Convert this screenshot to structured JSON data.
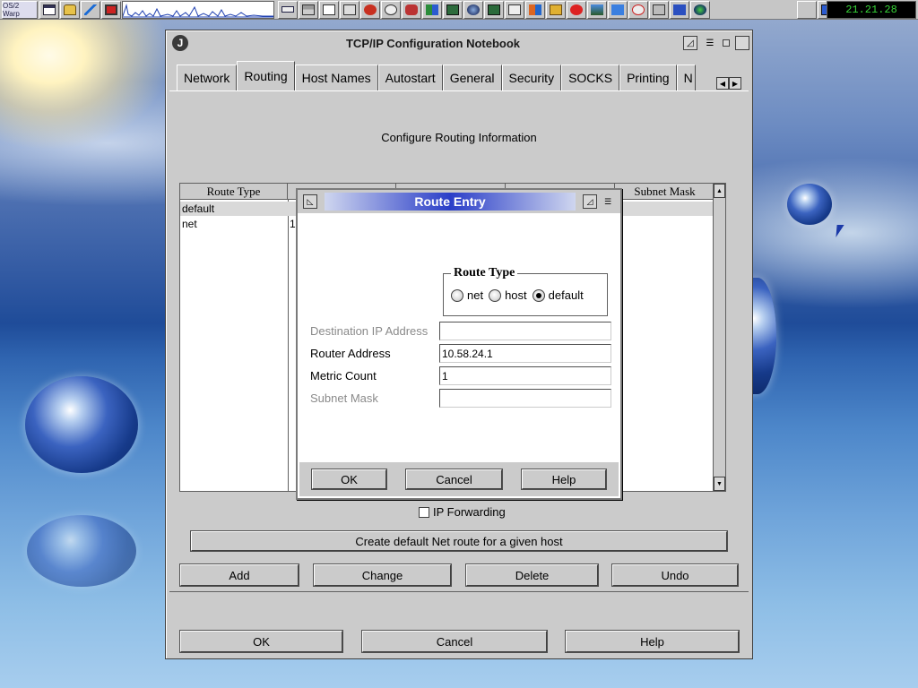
{
  "taskbar": {
    "logo": "OS/2 Warp",
    "clock": "21.21.28",
    "icons": [
      "window-list-icon",
      "lock-icon",
      "antenna-icon",
      "monitor-icon",
      "cpu-monitor",
      "keyboard-icon",
      "drives-icon",
      "telnet-icon",
      "notes-icon",
      "phone-icon",
      "disk-icon",
      "printer-icon",
      "network-icon",
      "browser-icon",
      "globe-icon",
      "irc-icon",
      "clipboard-icon",
      "people-icon",
      "folder-icon",
      "chat-icon",
      "image-icon",
      "edit-icon",
      "mail-icon",
      "tools-icon",
      "book-icon",
      "world-icon"
    ],
    "right_icons": [
      "help-icon"
    ]
  },
  "notebook": {
    "title": "TCP/IP Configuration Notebook",
    "tabs": [
      "Network",
      "Routing",
      "Host Names",
      "Autostart",
      "General",
      "Security",
      "SOCKS",
      "Printing",
      "N"
    ],
    "active_tab": "Routing",
    "heading": "Configure Routing Information",
    "table": {
      "columns": [
        "Route Type",
        "",
        "",
        "",
        "Subnet Mask"
      ],
      "rows": [
        {
          "type": "default",
          "col2": ""
        },
        {
          "type": "net",
          "col2": "1("
        }
      ]
    },
    "ip_forwarding_label": "IP Forwarding",
    "create_default_label": "Create default Net route for a given host",
    "buttons": {
      "add": "Add",
      "change": "Change",
      "delete": "Delete",
      "undo": "Undo"
    },
    "footer": {
      "ok": "OK",
      "cancel": "Cancel",
      "help": "Help"
    }
  },
  "dialog": {
    "title": "Route Entry",
    "route_type_label": "Route Type",
    "radios": [
      {
        "label": "net",
        "checked": false
      },
      {
        "label": "host",
        "checked": false
      },
      {
        "label": "default",
        "checked": true
      }
    ],
    "fields": {
      "destination": {
        "label": "Destination IP Address",
        "value": ""
      },
      "router": {
        "label": "Router Address",
        "value": "10.58.24.1"
      },
      "metric": {
        "label": "Metric Count",
        "value": "1"
      },
      "subnet": {
        "label": "Subnet Mask",
        "value": ""
      }
    },
    "buttons": {
      "ok": "OK",
      "cancel": "Cancel",
      "help": "Help"
    }
  }
}
